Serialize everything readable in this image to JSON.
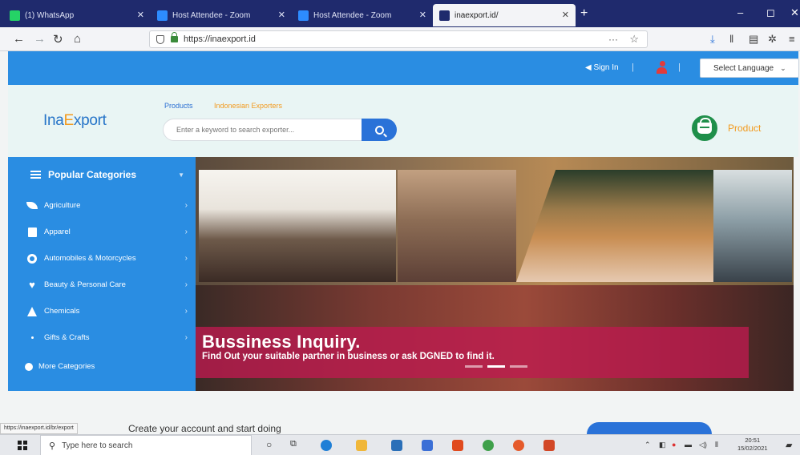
{
  "browser": {
    "tabs": [
      {
        "title": "(1) WhatsApp",
        "color": "#25d366",
        "active": false
      },
      {
        "title": "Host Attendee - Zoom",
        "color": "#2d8cff",
        "active": false
      },
      {
        "title": "Host Attendee - Zoom",
        "color": "#2d8cff",
        "active": false
      },
      {
        "title": "inaexport.id/",
        "color": "#1f2a6d",
        "active": true
      }
    ],
    "url": "https://inaexport.id",
    "status_url": "https://inaexport.id/br/export"
  },
  "site": {
    "signin_label": "Sign In",
    "language_label": "Select Language",
    "logo_text": {
      "part1": "Ina",
      "part2": "E",
      "part3": "xport"
    },
    "nav": {
      "products": "Products",
      "exporters": "Indonesian Exporters"
    },
    "search_placeholder": "Enter a keyword to search exporter...",
    "product_label": "Product"
  },
  "sidebar": {
    "title": "Popular Categories",
    "items": [
      {
        "label": "Agriculture",
        "icon": "leaf-icon"
      },
      {
        "label": "Apparel",
        "icon": "shirt-icon"
      },
      {
        "label": "Automobiles & Motorcycles",
        "icon": "gears-icon"
      },
      {
        "label": "Beauty & Personal Care",
        "icon": "heart-icon"
      },
      {
        "label": "Chemicals",
        "icon": "flask-icon"
      },
      {
        "label": "Gifts & Crafts",
        "icon": "gift-icon"
      },
      {
        "label": "More Categories",
        "icon": "plus-circle-icon"
      }
    ]
  },
  "banner": {
    "title": "Bussiness Inquiry.",
    "subtitle": "Find Out your suitable partner in business or ask DGNED to find it."
  },
  "below": {
    "cta_text": "Create your account and start doing"
  },
  "taskbar": {
    "search_placeholder": "Type here to search",
    "time": "20:51",
    "date": "15/02/2021"
  }
}
